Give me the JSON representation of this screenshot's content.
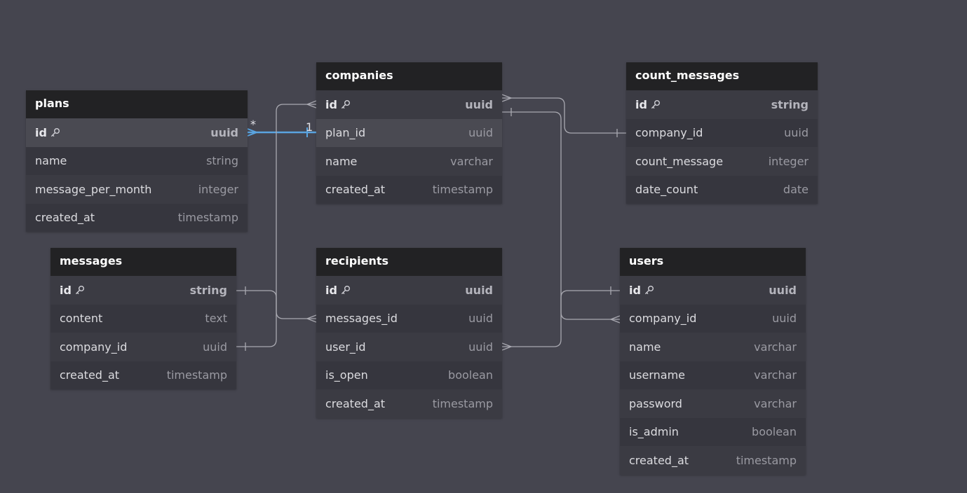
{
  "tables": {
    "plans": {
      "title": "plans",
      "fields": [
        {
          "name": "id",
          "type": "uuid",
          "pk": true
        },
        {
          "name": "name",
          "type": "string"
        },
        {
          "name": "message_per_month",
          "type": "integer"
        },
        {
          "name": "created_at",
          "type": "timestamp"
        }
      ]
    },
    "companies": {
      "title": "companies",
      "fields": [
        {
          "name": "id",
          "type": "uuid",
          "pk": true
        },
        {
          "name": "plan_id",
          "type": "uuid"
        },
        {
          "name": "name",
          "type": "varchar"
        },
        {
          "name": "created_at",
          "type": "timestamp"
        }
      ]
    },
    "count_messages": {
      "title": "count_messages",
      "fields": [
        {
          "name": "id",
          "type": "string",
          "pk": true
        },
        {
          "name": "company_id",
          "type": "uuid"
        },
        {
          "name": "count_message",
          "type": "integer"
        },
        {
          "name": "date_count",
          "type": "date"
        }
      ]
    },
    "messages": {
      "title": "messages",
      "fields": [
        {
          "name": "id",
          "type": "string",
          "pk": true
        },
        {
          "name": "content",
          "type": "text"
        },
        {
          "name": "company_id",
          "type": "uuid"
        },
        {
          "name": "created_at",
          "type": "timestamp"
        }
      ]
    },
    "recipients": {
      "title": "recipients",
      "fields": [
        {
          "name": "id",
          "type": "uuid",
          "pk": true
        },
        {
          "name": "messages_id",
          "type": "uuid"
        },
        {
          "name": "user_id",
          "type": "uuid"
        },
        {
          "name": "is_open",
          "type": "boolean"
        },
        {
          "name": "created_at",
          "type": "timestamp"
        }
      ]
    },
    "users": {
      "title": "users",
      "fields": [
        {
          "name": "id",
          "type": "uuid",
          "pk": true
        },
        {
          "name": "company_id",
          "type": "uuid"
        },
        {
          "name": "name",
          "type": "varchar"
        },
        {
          "name": "username",
          "type": "varchar"
        },
        {
          "name": "password",
          "type": "varchar"
        },
        {
          "name": "is_admin",
          "type": "boolean"
        },
        {
          "name": "created_at",
          "type": "timestamp"
        }
      ]
    }
  },
  "relationships": [
    {
      "from": "plans.id",
      "to": "companies.plan_id",
      "from_label": "*",
      "to_label": "1",
      "highlighted": true
    },
    {
      "from": "companies.id",
      "to": "messages.company_id"
    },
    {
      "from": "companies.id",
      "to": "count_messages.company_id"
    },
    {
      "from": "companies.id",
      "to": "users.company_id"
    },
    {
      "from": "messages.id",
      "to": "recipients.messages_id"
    },
    {
      "from": "users.id",
      "to": "recipients.user_id"
    }
  ],
  "colors": {
    "canvas": "#45454f",
    "header": "#222224",
    "line": "#a9a9b1",
    "highlight": "#5aa4e0"
  },
  "icons": {
    "primary_key": "key-icon"
  }
}
